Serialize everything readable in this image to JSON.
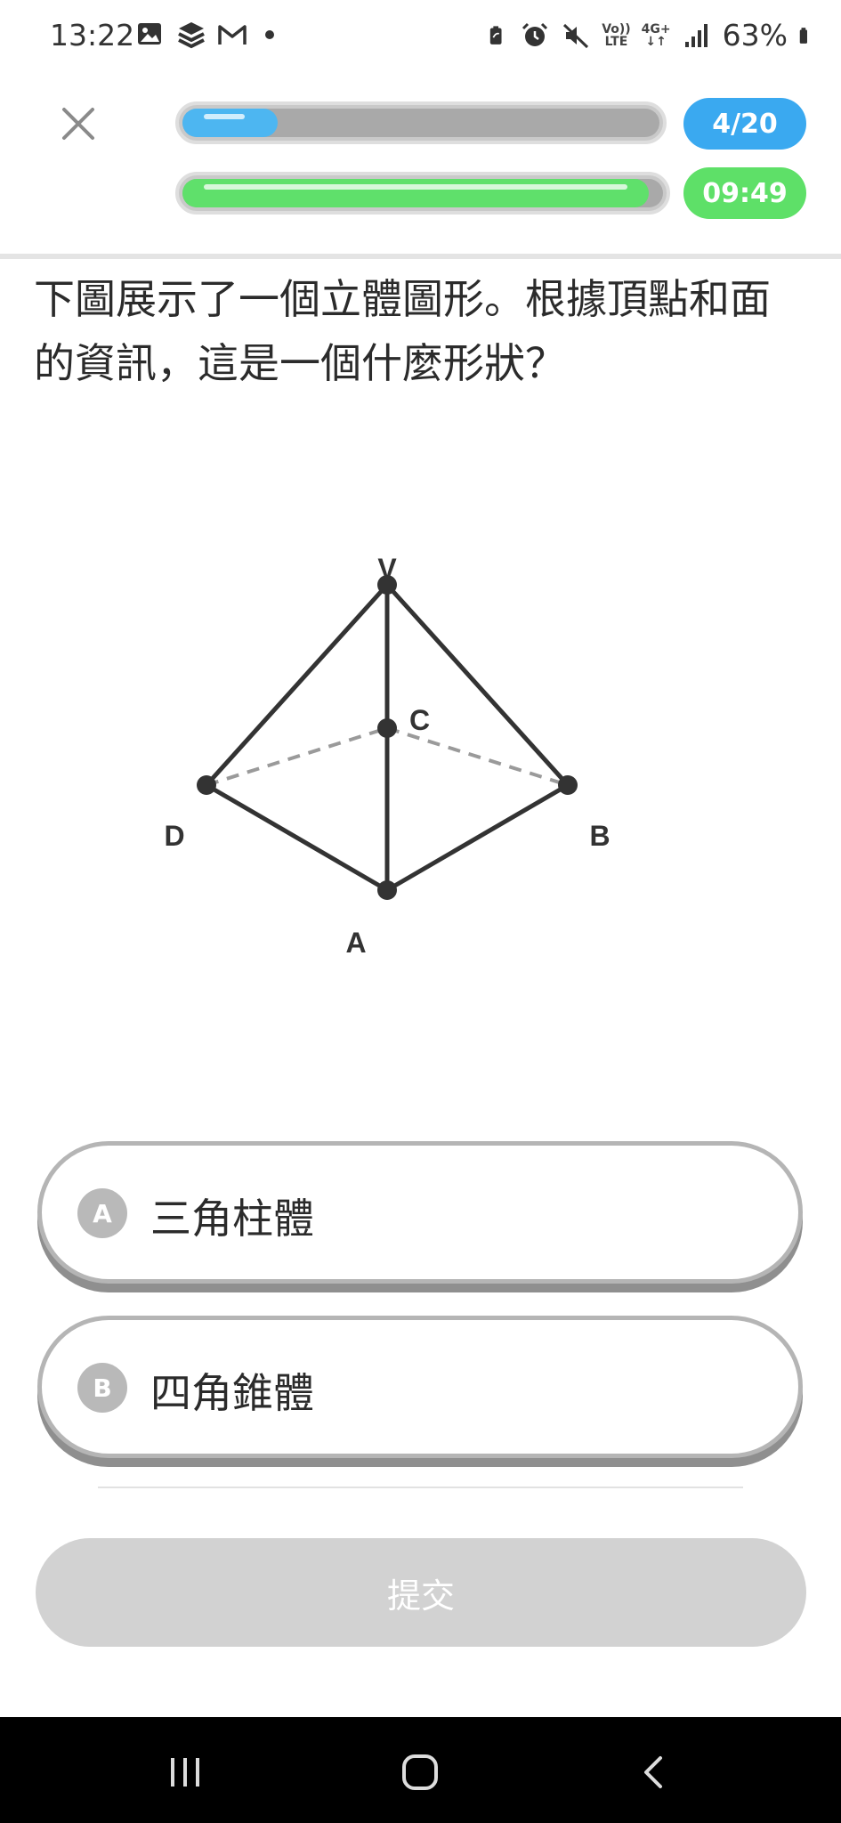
{
  "status_bar": {
    "time": "13:22",
    "left_icons": [
      "image-icon",
      "stack-icon",
      "gmail-icon",
      "dot-icon"
    ],
    "right_icons": [
      "battery-saver-icon",
      "alarm-icon",
      "mute-icon",
      "volte-icon",
      "4g-icon",
      "signal-icon"
    ],
    "volte_line1": "Vo))",
    "volte_line2": "LTE",
    "network_line1": "4G+",
    "network_line2": "↓↑",
    "battery": "63%"
  },
  "header": {
    "close_icon": "close-icon",
    "progress_fraction": 0.2,
    "timer_fraction": 0.97,
    "question_counter": "4/20",
    "timer": "09:49",
    "accent_blue": "#3aa9f0",
    "accent_green": "#5ee068"
  },
  "question": {
    "text": "下圖展示了一個立體圖形。根據頂點和面的資訊，這是一個什麼形狀？"
  },
  "figure": {
    "labels": {
      "v": "V",
      "c": "C",
      "d": "D",
      "b": "B",
      "a": "A"
    }
  },
  "options": [
    {
      "badge": "A",
      "label": "三角柱體"
    },
    {
      "badge": "B",
      "label": "四角錐體"
    }
  ],
  "submit": {
    "label": "提交"
  },
  "nav": {
    "recents_icon": "recents-icon",
    "home_icon": "home-icon",
    "back_icon": "back-icon"
  }
}
